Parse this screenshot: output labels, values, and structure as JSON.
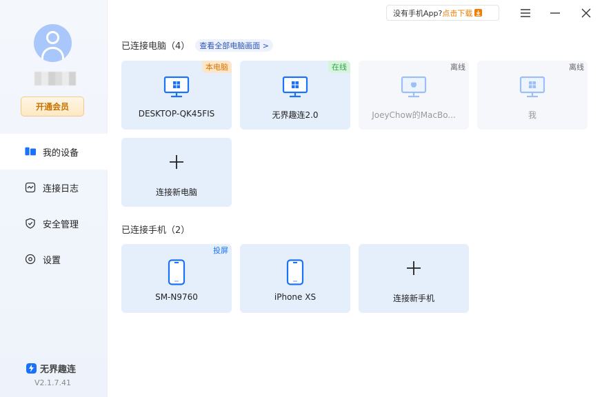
{
  "sidebar": {
    "vip_label": "开通会员",
    "items": [
      {
        "label": "我的设备",
        "icon": "devices-icon"
      },
      {
        "label": "连接日志",
        "icon": "log-icon"
      },
      {
        "label": "安全管理",
        "icon": "shield-icon"
      },
      {
        "label": "设置",
        "icon": "settings-icon"
      }
    ],
    "brand": "无界趣连",
    "version": "V2.1.7.41"
  },
  "topbar": {
    "promo_text": "没有手机App?",
    "promo_link": "点击下载"
  },
  "computers": {
    "title": "已连接电脑（4）",
    "view_all": "查看全部电脑画面 >",
    "items": [
      {
        "name": "DESKTOP-QK45FIS",
        "tag": "本电脑",
        "status": "local",
        "os": "windows"
      },
      {
        "name": "无界趣连2.0",
        "tag": "在线",
        "status": "online",
        "os": "windows"
      },
      {
        "name": "JoeyChow的MacBo...",
        "tag": "离线",
        "status": "offline",
        "os": "mac"
      },
      {
        "name": "我",
        "tag": "离线",
        "status": "offline",
        "os": "windows"
      }
    ],
    "add_label": "连接新电脑"
  },
  "phones": {
    "title": "已连接手机（2）",
    "items": [
      {
        "name": "SM-N9760",
        "tag": "投屏"
      },
      {
        "name": "iPhone XS",
        "tag": ""
      }
    ],
    "add_label": "连接新手机"
  },
  "colors": {
    "accent": "#1a73f7",
    "card_bg": "#e5eefb",
    "vip": "#c77400",
    "online": "#2aa84a",
    "local": "#d9770b"
  }
}
